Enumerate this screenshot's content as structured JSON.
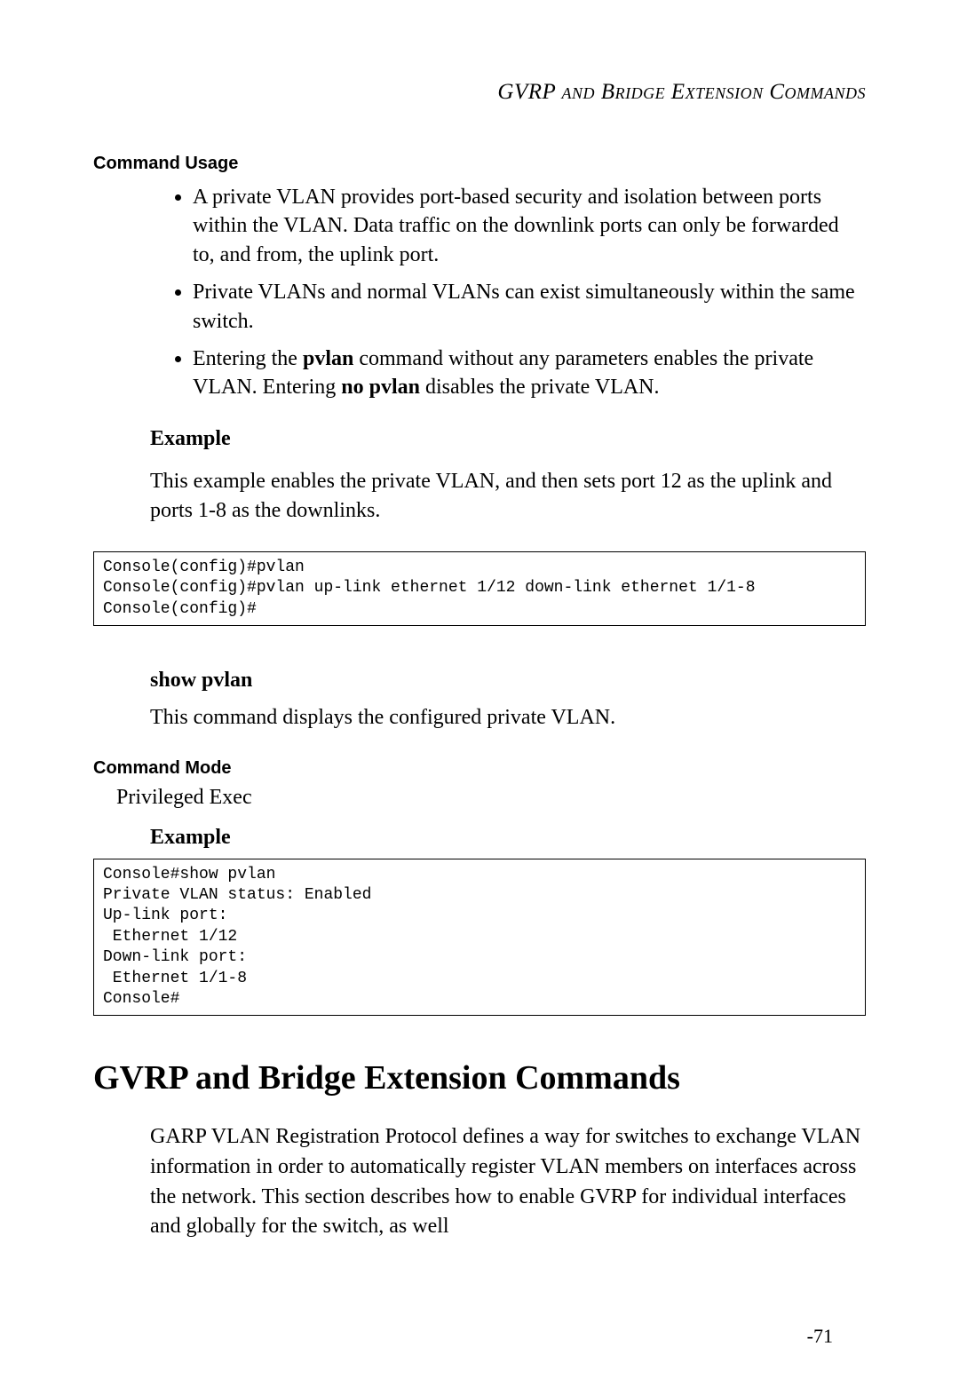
{
  "runningHeader": "GVRP and Bridge Extension Commands",
  "commandUsage": {
    "heading": "Command Usage",
    "bullets": {
      "b1_pre": "A private VLAN provides port-based security and isolation between ports within the VLAN. Data traffic on the downlink ports can only be forwarded to, and from, the uplink port.",
      "b2": "Private VLANs and normal VLANs can exist simultaneously within the same switch.",
      "b3_pre": "Entering the ",
      "b3_bold1": "pvlan",
      "b3_mid": " command without any parameters enables the private VLAN. Entering ",
      "b3_bold2": "no pvlan",
      "b3_post": " disables the private VLAN."
    }
  },
  "example1": {
    "heading": "Example",
    "intro": "This example enables the private VLAN, and then sets port 12 as the uplink and ports 1-8 as the downlinks.",
    "code": "Console(config)#pvlan\nConsole(config)#pvlan up-link ethernet 1/12 down-link ethernet 1/1-8\nConsole(config)#"
  },
  "showPvlan": {
    "heading": "show pvlan",
    "desc": "This command displays the configured private VLAN."
  },
  "commandMode": {
    "heading": "Command Mode",
    "value": "Privileged Exec"
  },
  "example2": {
    "heading": "Example",
    "code": "Console#show pvlan\nPrivate VLAN status: Enabled\nUp-link port:\n Ethernet 1/12\nDown-link port:\n Ethernet 1/1-8\nConsole#"
  },
  "mainSection": {
    "heading": "GVRP and Bridge Extension Commands",
    "para": "GARP VLAN Registration Protocol defines a way for switches to exchange VLAN information in order to automatically register VLAN members on interfaces across the network. This section describes how to enable GVRP for individual interfaces and globally for the switch, as well"
  },
  "pageNumber": "-71"
}
